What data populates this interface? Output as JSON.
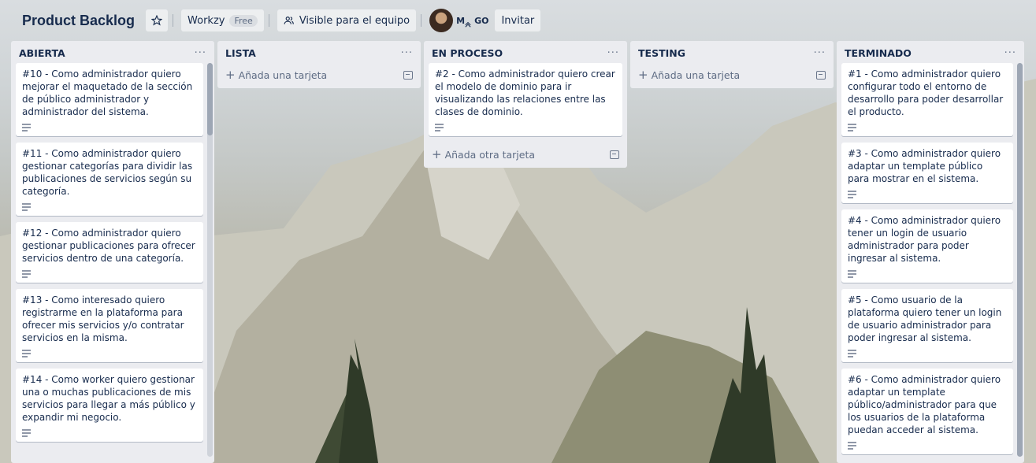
{
  "board": {
    "title": "Product Backlog",
    "workspace_label": "Workzy",
    "plan_badge": "Free",
    "visibility_label": "Visible para el equipo",
    "member_initials": "M",
    "member_extra": "GO",
    "invite_label": "Invitar"
  },
  "lists": [
    {
      "title": "ABIERTA",
      "menu": "···",
      "cards": [
        "#10 - Como administrador quiero mejorar el maquetado de la sección de público administrador y administrador del sistema.",
        "#11 - Como administrador quiero gestionar categorías para dividir las publicaciones de servicios según su categoría.",
        "#12 - Como administrador quiero gestionar publicaciones para ofrecer servicios dentro de una categoría.",
        "#13 - Como interesado quiero registrarme en la plataforma para ofrecer mis servicios y/o contratar servicios en la misma.",
        "#14 - Como worker quiero gestionar una o muchas publicaciones de mis servicios para llegar a más público y expandir mi negocio."
      ]
    },
    {
      "title": "LISTA",
      "menu": "···",
      "add_label": "Añada una tarjeta",
      "cards": []
    },
    {
      "title": "EN PROCESO",
      "menu": "···",
      "add_label": "Añada otra tarjeta",
      "cards": [
        "#2 - Como administrador quiero crear el modelo de dominio para ir visualizando las relaciones entre las clases de dominio."
      ]
    },
    {
      "title": "TESTING",
      "menu": "···",
      "add_label": "Añada una tarjeta",
      "cards": []
    },
    {
      "title": "TERMINADO",
      "menu": "···",
      "cards": [
        "#1 - Como administrador quiero configurar todo el entorno de desarrollo para poder desarrollar el producto.",
        "#3 - Como administrador quiero adaptar un template público para mostrar en el sistema.",
        "#4 - Como administrador quiero tener un login de usuario administrador para poder ingresar al sistema.",
        "#5 - Como usuario de la plataforma quiero tener un login de usuario administrador para poder ingresar al sistema.",
        "#6 - Como administrador quiero adaptar un template público/administrador para que los usuarios de la plataforma puedan acceder al sistema."
      ]
    }
  ],
  "colors": {
    "list_bg": "#ebecf0",
    "card_bg": "#ffffff",
    "text": "#172b4d",
    "muted": "#5e6c84"
  },
  "icons": {
    "star": "star-icon",
    "visibility": "team-visibility-icon",
    "description": "description-icon",
    "template": "card-template-icon",
    "add": "plus-icon",
    "menu": "more-icon"
  }
}
